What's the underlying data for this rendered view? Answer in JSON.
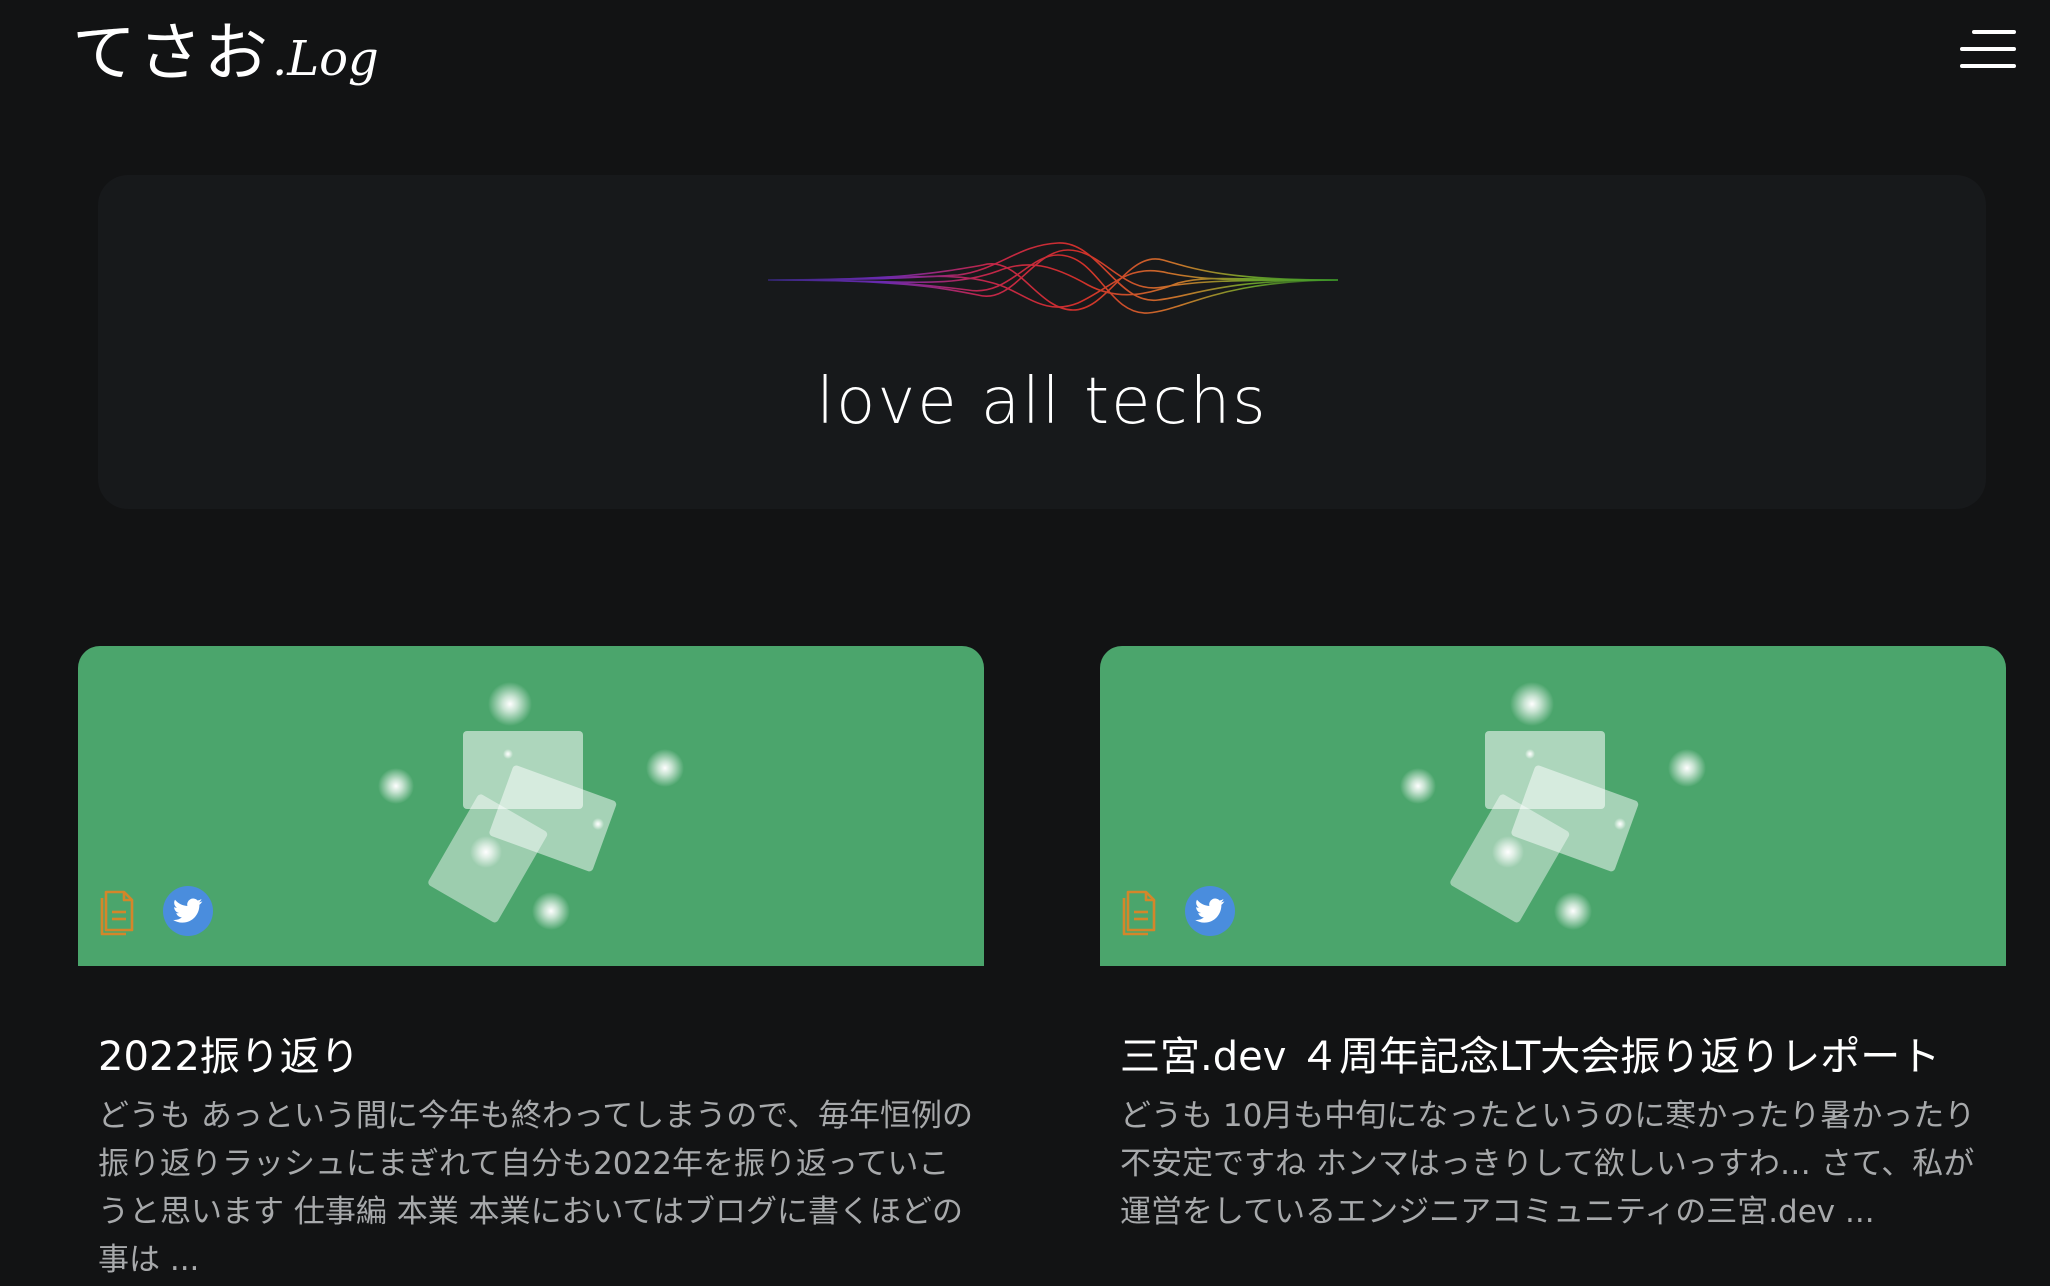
{
  "header": {
    "logo_jp": "てさお",
    "logo_sub": ".Log"
  },
  "hero": {
    "tagline": "love all techs"
  },
  "colors": {
    "background": "#121314",
    "hero_panel": "#17191b",
    "thumbnail": "#4ba56c",
    "twitter": "#4a8ddd",
    "doc_icon": "#d4862a",
    "excerpt_text": "#a7a9ab"
  },
  "posts": [
    {
      "title": "2022振り返り",
      "excerpt": "どうも あっという間に今年も終わってしまうので、毎年恒例の振り返りラッシュにまぎれて自分も2022年を振り返っていこうと思います 仕事編 本業 本業においてはブログに書くほどの事は ...",
      "icons": [
        "document-icon",
        "twitter-icon"
      ]
    },
    {
      "title": "三宮.dev ４周年記念LT大会振り返りレポート",
      "excerpt": "どうも 10月も中旬になったというのに寒かったり暑かったり不安定ですね ホンマはっきりして欲しいっすわ… さて、私が運営をしているエンジニアコミュニティの三宮.dev ...",
      "icons": [
        "document-icon",
        "twitter-icon"
      ]
    }
  ]
}
